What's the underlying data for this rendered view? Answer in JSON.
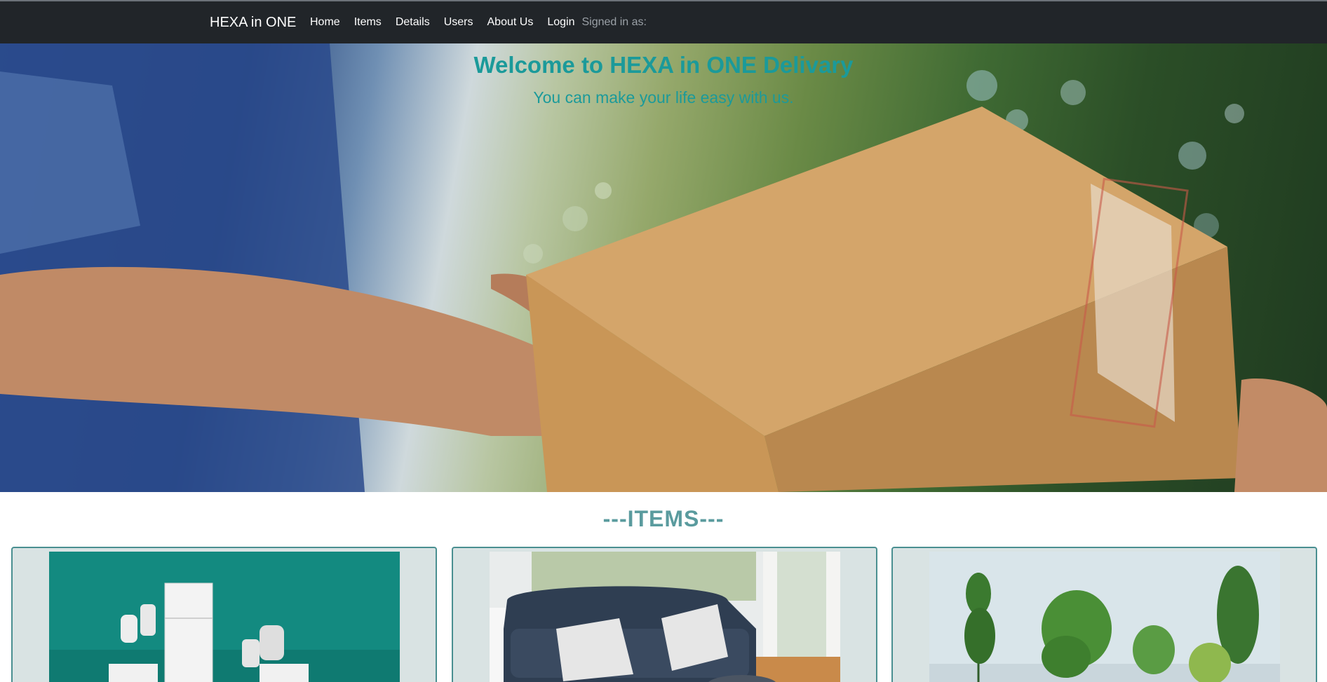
{
  "navbar": {
    "brand": "HEXA in ONE",
    "links": [
      {
        "label": "Home"
      },
      {
        "label": "Items"
      },
      {
        "label": "Details"
      },
      {
        "label": "Users"
      },
      {
        "label": "About Us"
      },
      {
        "label": "Login"
      }
    ],
    "signed_in_text": "Signed in as:"
  },
  "hero": {
    "title": "Welcome to HEXA in ONE Delivary",
    "subtitle": "You can make your life easy with us."
  },
  "items_section": {
    "heading": "---ITEMS---"
  },
  "colors": {
    "navbar_bg": "#212529",
    "accent_teal": "#1b9a9a",
    "card_bg": "#d9e3e3",
    "card_border": "#4a8f91"
  }
}
